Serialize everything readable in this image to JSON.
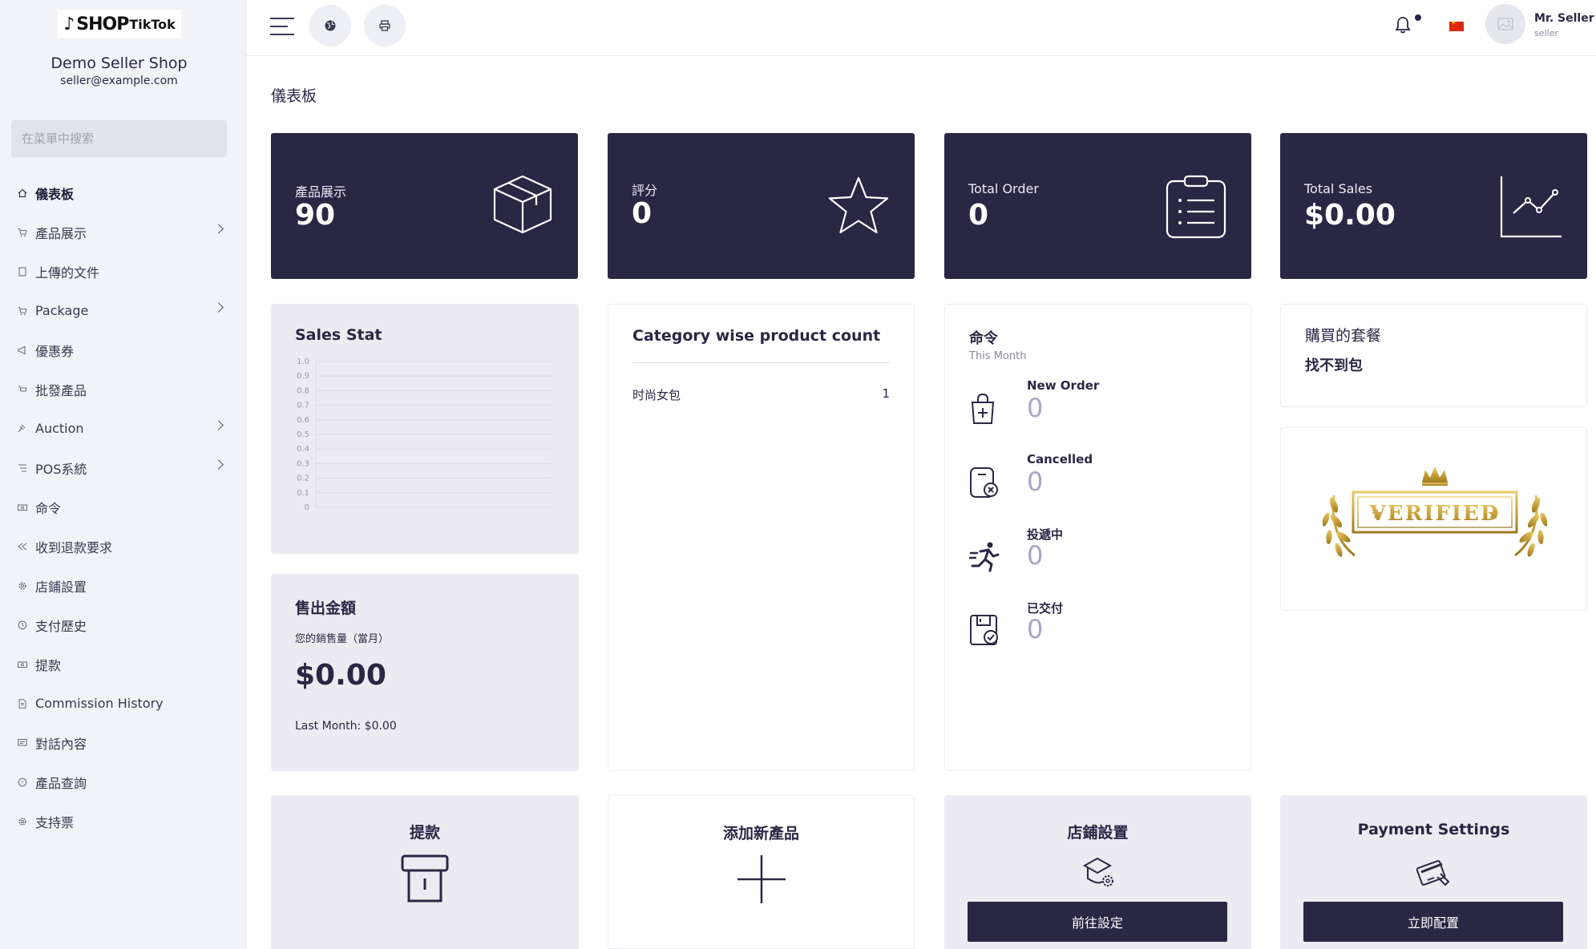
{
  "sidebar": {
    "logo_shop": "SHOP",
    "logo_brand": "TikTok",
    "shop_name": "Demo Seller Shop",
    "shop_email": "seller@example.com",
    "search_placeholder": "在菜單中搜索",
    "items": [
      {
        "label": "儀表板",
        "icon": "home-icon",
        "active": true,
        "chevron": false
      },
      {
        "label": "產品展示",
        "icon": "cart-icon",
        "active": false,
        "chevron": true
      },
      {
        "label": "上傳的文件",
        "icon": "folder-icon",
        "active": false,
        "chevron": false
      },
      {
        "label": "Package",
        "icon": "cart-icon",
        "active": false,
        "chevron": true
      },
      {
        "label": "優惠券",
        "icon": "megaphone-icon",
        "active": false,
        "chevron": false
      },
      {
        "label": "批發產品",
        "icon": "wholesale-icon",
        "active": false,
        "chevron": false
      },
      {
        "label": "Auction",
        "icon": "gavel-icon",
        "active": false,
        "chevron": true
      },
      {
        "label": "POS系統",
        "icon": "list-icon",
        "active": false,
        "chevron": true
      },
      {
        "label": "命令",
        "icon": "money-icon",
        "active": false,
        "chevron": false
      },
      {
        "label": "收到退款要求",
        "icon": "refund-icon",
        "active": false,
        "chevron": false
      },
      {
        "label": "店鋪設置",
        "icon": "gear-icon",
        "active": false,
        "chevron": false
      },
      {
        "label": "支付歷史",
        "icon": "history-icon",
        "active": false,
        "chevron": false
      },
      {
        "label": "提款",
        "icon": "money-icon",
        "active": false,
        "chevron": false
      },
      {
        "label": "Commission History",
        "icon": "document-icon",
        "active": false,
        "chevron": false
      },
      {
        "label": "對話內容",
        "icon": "chat-icon",
        "active": false,
        "chevron": false
      },
      {
        "label": "產品查詢",
        "icon": "question-icon",
        "active": false,
        "chevron": false
      },
      {
        "label": "支持票",
        "icon": "support-icon",
        "active": false,
        "chevron": false
      }
    ]
  },
  "topbar": {
    "user_name": "Mr. Seller",
    "user_role": "seller"
  },
  "page_title": "儀表板",
  "stats": [
    {
      "label": "產品展示",
      "value": "90",
      "icon": "box-icon"
    },
    {
      "label": "評分",
      "value": "0",
      "icon": "star-icon"
    },
    {
      "label": "Total Order",
      "value": "0",
      "icon": "clipboard-icon"
    },
    {
      "label": "Total Sales",
      "value": "$0.00",
      "icon": "line-chart-icon"
    }
  ],
  "sales_stat": {
    "title": "Sales Stat"
  },
  "chart_data": {
    "type": "bar",
    "title": "Sales Stat",
    "categories": [],
    "values": [],
    "yticks": [
      "1.0",
      "0.9",
      "0.8",
      "0.7",
      "0.6",
      "0.5",
      "0.4",
      "0.3",
      "0.2",
      "0.1",
      "0"
    ],
    "ylim": [
      0,
      1
    ],
    "grid": true
  },
  "sold_amount": {
    "title": "售出金額",
    "subtitle": "您的銷售量（當月）",
    "amount": "$0.00",
    "last_month": "Last Month: $0.00"
  },
  "category": {
    "title": "Category wise product count",
    "rows": [
      {
        "name": "时尚女包",
        "count": "1"
      }
    ]
  },
  "orders": {
    "title": "命令",
    "subtitle": "This Month",
    "items": [
      {
        "label": "New Order",
        "value": "0",
        "icon": "new-order-bag-icon"
      },
      {
        "label": "Cancelled",
        "value": "0",
        "icon": "cancelled-icon"
      },
      {
        "label": "投遞中",
        "value": "0",
        "icon": "delivery-runner-icon"
      },
      {
        "label": "已交付",
        "value": "0",
        "icon": "delivered-icon"
      }
    ]
  },
  "package": {
    "title": "購買的套餐",
    "value": "找不到包"
  },
  "verified_badge": {
    "text": "VERIFIED"
  },
  "actions": [
    {
      "title": "提款",
      "icon": "withdraw-icon",
      "button": ""
    },
    {
      "title": "添加新產品",
      "icon": "plus-icon",
      "button": ""
    },
    {
      "title": "店鋪設置",
      "icon": "shop-settings-icon",
      "button": "前往設定"
    },
    {
      "title": "Payment Settings",
      "icon": "payment-card-icon",
      "button": "立即配置"
    }
  ],
  "colors": {
    "primary": "#2a2744",
    "sidebar_bg": "#f2f3f8",
    "card_gray": "#ebebf1",
    "order_value": "#a8a6c6",
    "gold": "#c9a23c"
  }
}
